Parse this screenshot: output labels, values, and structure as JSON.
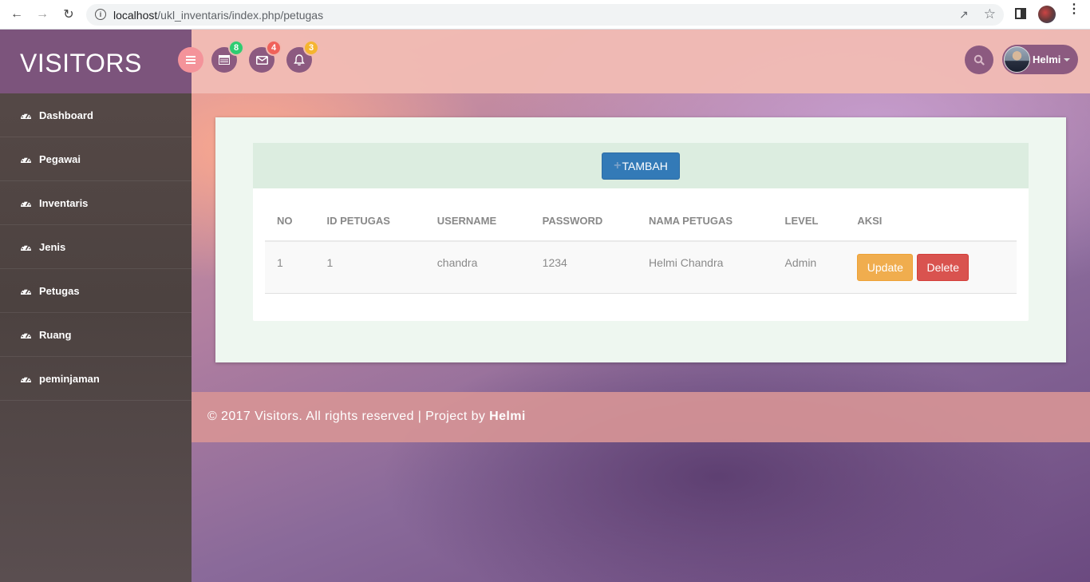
{
  "browser": {
    "url_host": "localhost",
    "url_path": "/ukl_inventaris/index.php/petugas"
  },
  "brand": "VISITORS",
  "sidebar": {
    "items": [
      {
        "label": "Dashboard",
        "icon": "dashboard-icon"
      },
      {
        "label": "Pegawai",
        "icon": "dashboard-icon"
      },
      {
        "label": "Inventaris",
        "icon": "dashboard-icon"
      },
      {
        "label": "Jenis",
        "icon": "dashboard-icon"
      },
      {
        "label": "Petugas",
        "icon": "dashboard-icon"
      },
      {
        "label": "Ruang",
        "icon": "dashboard-icon"
      },
      {
        "label": "peminjaman",
        "icon": "dashboard-icon"
      }
    ]
  },
  "topbar": {
    "tasks_badge": "8",
    "messages_badge": "4",
    "notifications_badge": "3",
    "user_name": "Helmi",
    "colors": {
      "tasks": "#2ecc71",
      "messages": "#f0625a",
      "notifications": "#f5b530"
    }
  },
  "main": {
    "add_button": "TAMBAH",
    "table": {
      "headers": [
        "NO",
        "ID PETUGAS",
        "USERNAME",
        "PASSWORD",
        "NAMA PETUGAS",
        "LEVEL",
        "AKSI"
      ],
      "rows": [
        {
          "no": "1",
          "id": "1",
          "username": "chandra",
          "password": "1234",
          "nama": "Helmi Chandra",
          "level": "Admin",
          "update": "Update",
          "delete": "Delete"
        }
      ]
    }
  },
  "footer": {
    "text": "© 2017 Visitors. All rights reserved | Project by",
    "author": "Helmi"
  }
}
